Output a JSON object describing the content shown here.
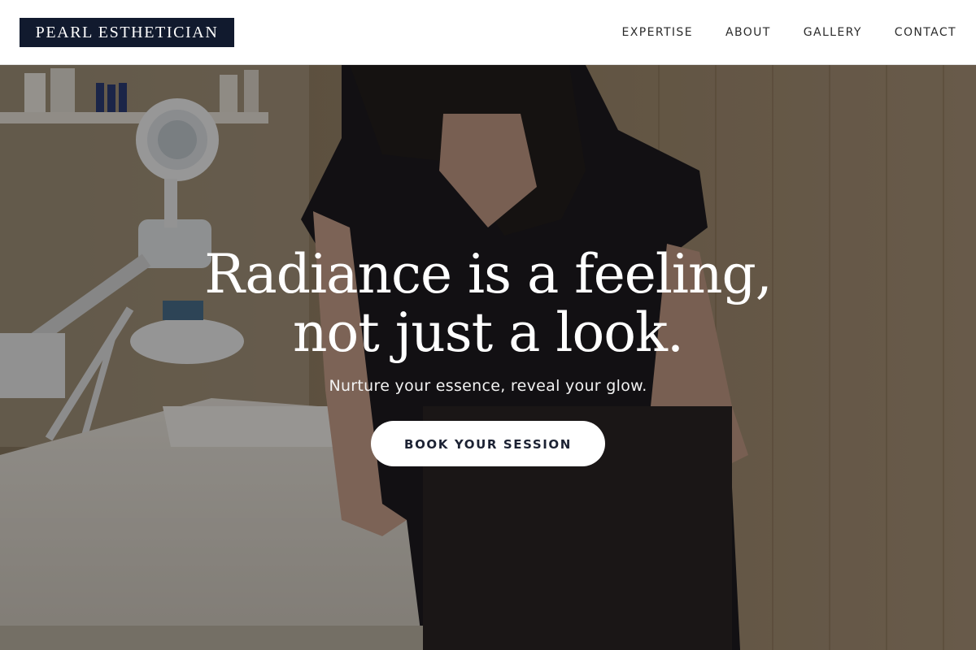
{
  "brand": {
    "name": "PEARL ESTHETICIAN",
    "logo_bg": "#111a2e"
  },
  "nav": {
    "items": [
      {
        "label": "EXPERTISE"
      },
      {
        "label": "ABOUT"
      },
      {
        "label": "GALLERY"
      },
      {
        "label": "CONTACT"
      }
    ]
  },
  "hero": {
    "title_line1": "Radiance is a feeling,",
    "title_line2": "not just a look.",
    "subtitle": "Nurture your essence, reveal your glow.",
    "cta_label": "BOOK YOUR SESSION",
    "image_description": "esthetician-in-black-tshirt-leaning-on-treatment-bed"
  },
  "colors": {
    "navy": "#111a2e",
    "white": "#ffffff"
  }
}
